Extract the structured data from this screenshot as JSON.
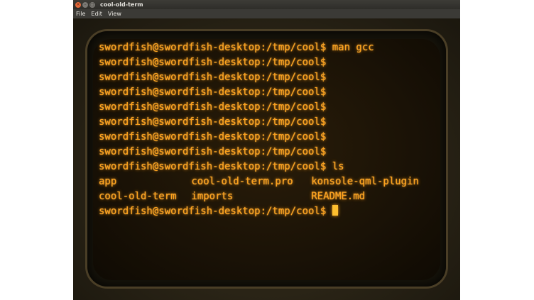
{
  "window": {
    "title": "cool-old-term",
    "buttons": {
      "close_icon": "×",
      "minimize_icon": "–",
      "maximize_icon": "□"
    }
  },
  "menubar": {
    "items": [
      {
        "label": "File"
      },
      {
        "label": "Edit"
      },
      {
        "label": "View"
      }
    ]
  },
  "terminal": {
    "text_color": "#ffa21c",
    "background_color": "#1a1206",
    "prompt_lines": [
      "swordfish@swordfish-desktop:/tmp/cool$ man gcc",
      "swordfish@swordfish-desktop:/tmp/cool$",
      "swordfish@swordfish-desktop:/tmp/cool$",
      "swordfish@swordfish-desktop:/tmp/cool$",
      "swordfish@swordfish-desktop:/tmp/cool$",
      "swordfish@swordfish-desktop:/tmp/cool$",
      "swordfish@swordfish-desktop:/tmp/cool$",
      "swordfish@swordfish-desktop:/tmp/cool$",
      "swordfish@swordfish-desktop:/tmp/cool$ ls"
    ],
    "ls_output": [
      [
        "app",
        "cool-old-term.pro",
        "konsole-qml-plugin"
      ],
      [
        "cool-old-term",
        "imports",
        "README.md"
      ]
    ],
    "current_prompt": "swordfish@swordfish-desktop:/tmp/cool$ "
  }
}
